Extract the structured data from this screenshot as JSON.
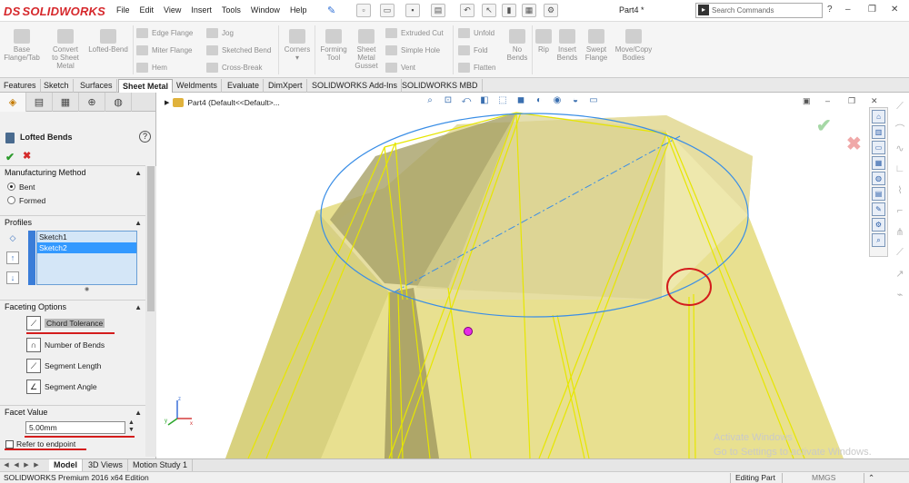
{
  "app": {
    "brand": "SOLIDWORKS",
    "brand_mark": "DS",
    "menu": [
      "File",
      "Edit",
      "View",
      "Insert",
      "Tools",
      "Window",
      "Help"
    ],
    "document_title": "Part4 *",
    "search_placeholder": "Search Commands",
    "window_controls": [
      "?",
      "–",
      "❐",
      "✕"
    ]
  },
  "ribbon": {
    "big_buttons": [
      {
        "label": "Base Flange/Tab",
        "lines": [
          "Base",
          "Flange/Tab"
        ]
      },
      {
        "label": "Convert to Sheet Metal",
        "lines": [
          "Convert",
          "to Sheet",
          "Metal"
        ]
      },
      {
        "label": "Lofted-Bend",
        "lines": [
          "Lofted-Bend"
        ]
      },
      {
        "label": "Corners",
        "lines": [
          "Corners"
        ]
      },
      {
        "label": "Forming Tool",
        "lines": [
          "Forming",
          "Tool"
        ]
      },
      {
        "label": "Sheet Metal Gusset",
        "lines": [
          "Sheet",
          "Metal",
          "Gusset"
        ]
      },
      {
        "label": "No Bends",
        "lines": [
          "No",
          "Bends"
        ]
      },
      {
        "label": "Rip",
        "lines": [
          "Rip"
        ]
      },
      {
        "label": "Insert Bends",
        "lines": [
          "Insert",
          "Bends"
        ]
      },
      {
        "label": "Swept Flange",
        "lines": [
          "Swept",
          "Flange"
        ]
      },
      {
        "label": "Move/Copy Bodies",
        "lines": [
          "Move/Copy",
          "Bodies"
        ]
      }
    ],
    "small_buttons": {
      "col1": [
        "Edge Flange",
        "Miter Flange",
        "Hem"
      ],
      "col2": [
        "Jog",
        "Sketched Bend",
        "Cross-Break"
      ],
      "col3": [
        "Extruded Cut",
        "Simple Hole",
        "Vent"
      ],
      "col4": [
        "Unfold",
        "Fold",
        "Flatten"
      ]
    }
  },
  "command_tabs": [
    "Features",
    "Sketch",
    "Surfaces",
    "Sheet Metal",
    "Weldments",
    "Evaluate",
    "DimXpert",
    "SOLIDWORKS Add-Ins",
    "SOLIDWORKS MBD"
  ],
  "active_command_tab": "Sheet Metal",
  "property_manager": {
    "title": "Lofted Bends",
    "help": "?",
    "ok": "✔",
    "cancel": "✖",
    "manufacturing": {
      "header": "Manufacturing Method",
      "options": [
        "Bent",
        "Formed"
      ],
      "selected": "Bent"
    },
    "profiles": {
      "header": "Profiles",
      "items": [
        "Sketch1",
        "Sketch2"
      ],
      "selected": "Sketch2"
    },
    "faceting": {
      "header": "Faceting Options",
      "options": [
        "Chord Tolerance",
        "Number of Bends",
        "Segment Length",
        "Segment Angle"
      ],
      "selected": "Chord Tolerance"
    },
    "facet_value": {
      "header": "Facet Value",
      "value": "5.00mm"
    },
    "refer_endpoint": "Refer to endpoint"
  },
  "viewport": {
    "breadcrumb": "Part4  (Default<<Default>...",
    "part_color": "#e4dd8e",
    "edge_color": "#e6e600",
    "sketch_color": "#3a8ee6",
    "highlight_color": "#d41c1c",
    "watermark": [
      "Activate Windows",
      "Go to Settings to activate Windows."
    ]
  },
  "bottom_tabs": [
    "Model",
    "3D Views",
    "Motion Study 1"
  ],
  "active_bottom_tab": "Model",
  "status": {
    "product": "SOLIDWORKS Premium 2016 x64 Edition",
    "mode": "Editing Part",
    "units": "MMGS",
    "arrow": "⌃"
  }
}
